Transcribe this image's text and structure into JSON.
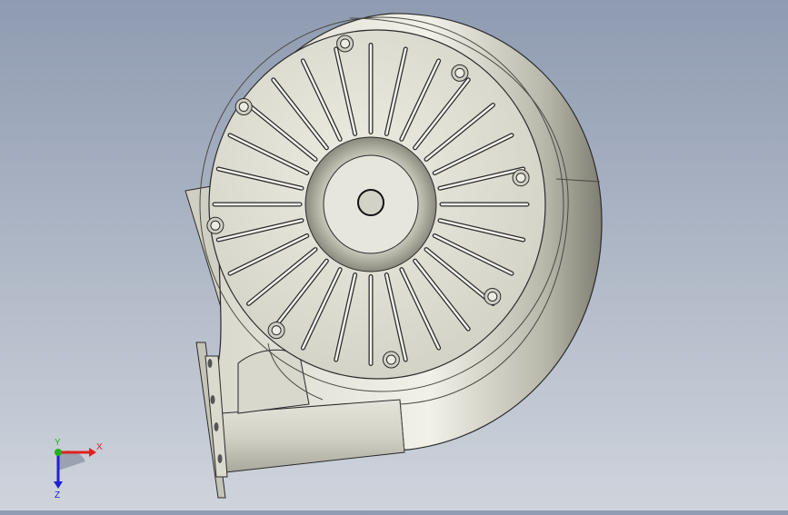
{
  "colors": {
    "background_top": "#8f9bb1",
    "background_bottom": "#cfd4dc",
    "part_light": "#e6e6dc",
    "part_mid": "#c9c9bd",
    "part_dark": "#8e8e82",
    "edge": "#2a2a2a",
    "axis_x": "#e02020",
    "axis_y": "#20b020",
    "axis_z": "#2020d0"
  },
  "viewport": {
    "model": "centrifugal-blower-housing",
    "bolt_holes": 8,
    "radial_slots": 28
  },
  "triad": {
    "x_label": "X",
    "y_label": "Y",
    "z_label": "Z"
  }
}
